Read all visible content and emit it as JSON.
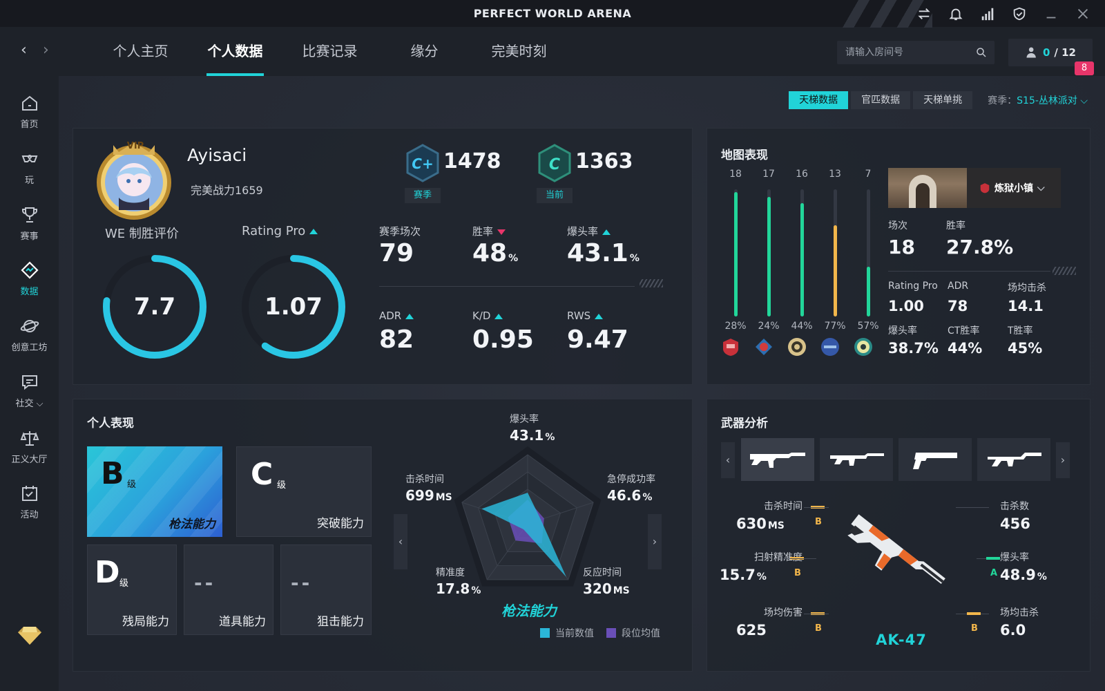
{
  "app": {
    "title": "PERFECT WORLD ARENA"
  },
  "nav": {
    "tabs": [
      "个人主页",
      "个人数据",
      "比赛记录",
      "缘分",
      "完美时刻"
    ],
    "search_placeholder": "请输入房间号",
    "room_current": "0",
    "room_total": "/ 12",
    "notification_badge": "8"
  },
  "sidebar": [
    {
      "label": "首页",
      "icon": "home-icon"
    },
    {
      "label": "玩",
      "icon": "gamepad-icon"
    },
    {
      "label": "赛事",
      "icon": "trophy-icon"
    },
    {
      "label": "数据",
      "icon": "data-icon"
    },
    {
      "label": "创意工坊",
      "icon": "planet-icon"
    },
    {
      "label": "社交",
      "icon": "chat-icon"
    },
    {
      "label": "正义大厅",
      "icon": "scales-icon"
    },
    {
      "label": "活动",
      "icon": "calendar-icon"
    }
  ],
  "filters": {
    "tabs": [
      "天梯数据",
      "官匹数据",
      "天梯单挑"
    ],
    "season_label": "赛季：",
    "season_value": "S15-丛林派对"
  },
  "profile": {
    "vip": "VIP",
    "name": "Ayisaci",
    "power": "完美战力1659",
    "rank_season": {
      "score": "1478",
      "tag": "赛季",
      "grade": "C+"
    },
    "rank_current": {
      "score": "1363",
      "tag": "当前",
      "grade": "C"
    },
    "we_label": "WE 制胜评价",
    "we_value": "7.7",
    "we_fraction": 0.77,
    "rating_label": "Rating Pro",
    "rating_value": "1.07",
    "rating_fraction": 0.6,
    "stats": [
      {
        "label": "赛季场次",
        "value": "79",
        "unit": "",
        "trend": ""
      },
      {
        "label": "胜率",
        "value": "48",
        "unit": "%",
        "trend": "down"
      },
      {
        "label": "爆头率",
        "value": "43.1",
        "unit": "%",
        "trend": "up"
      },
      {
        "label": "ADR",
        "value": "82",
        "unit": "",
        "trend": "up"
      },
      {
        "label": "K/D",
        "value": "0.95",
        "unit": "",
        "trend": "up"
      },
      {
        "label": "RWS",
        "value": "9.47",
        "unit": "",
        "trend": "up"
      }
    ]
  },
  "maps": {
    "title": "地图表现",
    "bars": [
      {
        "matches": "18",
        "winrate": "28%",
        "fill": 0.98,
        "color": "#22d69a"
      },
      {
        "matches": "17",
        "winrate": "24%",
        "fill": 0.94,
        "color": "#22d69a"
      },
      {
        "matches": "16",
        "winrate": "44%",
        "fill": 0.89,
        "color": "#22d69a"
      },
      {
        "matches": "13",
        "winrate": "77%",
        "fill": 0.72,
        "color": "#f2b64b"
      },
      {
        "matches": "7",
        "winrate": "57%",
        "fill": 0.39,
        "color": "#22d69a"
      }
    ],
    "selected_map": "炼狱小镇",
    "matches_label": "场次",
    "matches_value": "18",
    "winrate_label": "胜率",
    "winrate_value": "27.8%",
    "detail": [
      {
        "label": "Rating Pro",
        "value": "1.00"
      },
      {
        "label": "ADR",
        "value": "78"
      },
      {
        "label": "场均击杀",
        "value": "14.1"
      },
      {
        "label": "爆头率",
        "value": "38.7%"
      },
      {
        "label": "CT胜率",
        "value": "44%"
      },
      {
        "label": "T胜率",
        "value": "45%"
      }
    ]
  },
  "performance": {
    "title": "个人表现",
    "cards": [
      {
        "grade": "B",
        "sub": "级",
        "name": "枪法能力"
      },
      {
        "grade": "C",
        "sub": "级",
        "name": "突破能力"
      },
      {
        "grade": "D",
        "sub": "级",
        "name": "残局能力"
      },
      {
        "grade": "--",
        "sub": "",
        "name": "道具能力"
      },
      {
        "grade": "--",
        "sub": "",
        "name": "狙击能力"
      }
    ],
    "radar_title": "枪法能力",
    "radar_axes": [
      {
        "label": "爆头率",
        "value": "43.1",
        "unit": "%",
        "current": 0.45,
        "avg": 0.35
      },
      {
        "label": "急停成功率",
        "value": "46.6",
        "unit": "%",
        "current": 0.2,
        "avg": 0.25
      },
      {
        "label": "反应时间",
        "value": "320",
        "unit": "MS",
        "current": 0.95,
        "avg": 0.35
      },
      {
        "label": "精准度",
        "value": "17.8",
        "unit": "%",
        "current": 0.1,
        "avg": 0.3
      },
      {
        "label": "击杀时间",
        "value": "699",
        "unit": "MS",
        "current": 0.7,
        "avg": 0.3
      }
    ],
    "legend": [
      {
        "label": "当前数值",
        "color": "#2bb6d8"
      },
      {
        "label": "段位均值",
        "color": "#6a4fb8"
      }
    ]
  },
  "weapons": {
    "title": "武器分析",
    "thumbs": [
      "ak47-icon",
      "m4-icon",
      "pistol-icon",
      "famas-icon"
    ],
    "name": "AK-47",
    "stats_left": [
      {
        "label": "击杀时间",
        "value": "630",
        "unit": "MS",
        "grade": "B"
      },
      {
        "label": "扫射精准度",
        "value": "15.7",
        "unit": "%",
        "grade": "B"
      },
      {
        "label": "场均伤害",
        "value": "625",
        "unit": "",
        "grade": "B"
      }
    ],
    "stats_right": [
      {
        "label": "击杀数",
        "value": "456",
        "unit": "",
        "grade": ""
      },
      {
        "label": "爆头率",
        "value": "48.9",
        "unit": "%",
        "grade": "A"
      },
      {
        "label": "场均击杀",
        "value": "6.0",
        "unit": "",
        "grade": "B"
      }
    ]
  }
}
